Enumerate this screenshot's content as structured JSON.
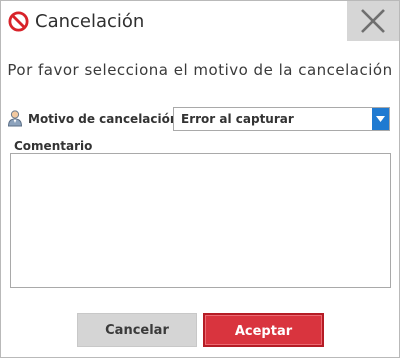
{
  "dialog": {
    "title": "Cancelación",
    "subtitle": "Por favor selecciona el motivo de la cancelación"
  },
  "form": {
    "reason_label": "Motivo de cancelación:",
    "reason_selected": "Error al capturar",
    "comment_label": "Comentario",
    "comment_value": ""
  },
  "buttons": {
    "cancel_label": "Cancelar",
    "accept_label": "Aceptar"
  },
  "icons": {
    "title_icon": "prohibited-icon",
    "close_icon": "close-icon",
    "reason_icon": "user-icon",
    "dropdown_icon": "chevron-down-icon"
  },
  "colors": {
    "accent_blue": "#1f7ad1",
    "accept_red": "#d9343e",
    "prohibited_red": "#d8232a",
    "close_bg": "#d6d6d6",
    "cancel_bg": "#d5d5d5"
  }
}
